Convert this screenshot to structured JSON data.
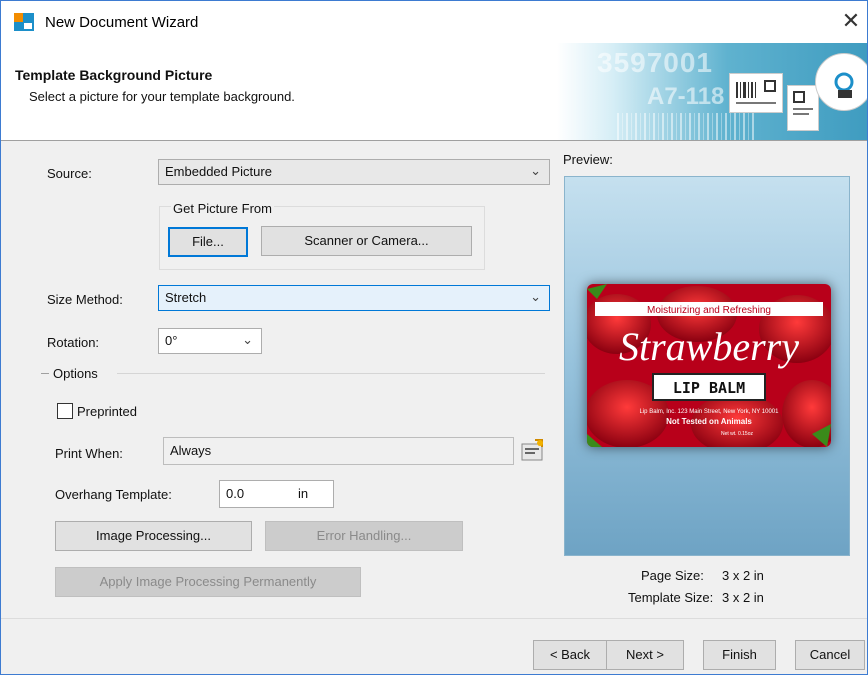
{
  "window": {
    "title": "New Document Wizard",
    "close_glyph": "✕"
  },
  "header": {
    "title": "Template Background Picture",
    "subtitle": "Select a picture for your template background.",
    "banner_text_1": "3597001",
    "banner_text_2": "A7-118"
  },
  "form": {
    "source_label": "Source:",
    "source_value": "Embedded Picture",
    "get_picture_group": "Get Picture From",
    "file_button": "File...",
    "scanner_button": "Scanner or Camera...",
    "size_method_label": "Size Method:",
    "size_method_value": "Stretch",
    "rotation_label": "Rotation:",
    "rotation_value": "0°",
    "options_label": "Options",
    "preprinted_label": "Preprinted",
    "preprinted_checked": false,
    "print_when_label": "Print When:",
    "print_when_value": "Always",
    "overhang_label": "Overhang Template:",
    "overhang_value": "0.0",
    "overhang_unit": "in",
    "image_processing_button": "Image Processing...",
    "error_handling_button": "Error Handling...",
    "apply_permanently_button": "Apply Image Processing Permanently"
  },
  "preview": {
    "label": "Preview:",
    "card_top_text": "Moisturizing and Refreshing",
    "card_title": "Strawberry",
    "card_badge": "LIP BALM",
    "card_address": "Lip Balm, Inc. 123 Main Street, New York, NY 10001",
    "card_note": "Not Tested on Animals",
    "card_weight": "Net wt. 0.15oz",
    "page_size_label": "Page Size:",
    "page_size_value": "3 x 2 in",
    "template_size_label": "Template Size:",
    "template_size_value": "3 x 2 in"
  },
  "footer": {
    "back_button": "< Back",
    "next_button": "Next >",
    "finish_button": "Finish",
    "cancel_button": "Cancel"
  },
  "colors": {
    "accent": "#0078d7",
    "card_red": "#c8102e",
    "preview_bg": "#96c2dc"
  },
  "icons": [
    "app-logo-icon",
    "close-icon",
    "chevron-down-icon",
    "value-picker-icon"
  ]
}
